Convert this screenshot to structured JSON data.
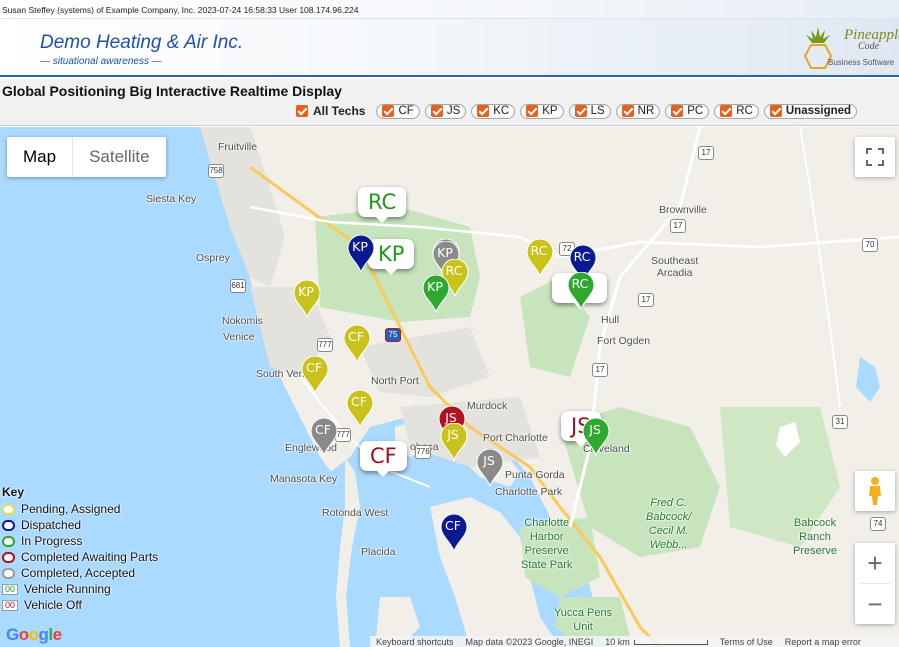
{
  "status_bar": "Susan Steffey (systems) of Example Company, Inc. 2023-07-24 16:58:33 User 108.174.96.224",
  "header": {
    "company": "Demo Heating & Air Inc.",
    "tagline": "— situational awareness —",
    "logo": {
      "name": "Pineapple",
      "sub": "Code",
      "biz": "Business Software"
    }
  },
  "page_title": "Global Positioning Big Interactive Realtime Display",
  "filters": {
    "all_label": "All Techs",
    "techs": [
      "CF",
      "JS",
      "KC",
      "KP",
      "LS",
      "NR",
      "PC",
      "RC"
    ],
    "unassigned_label": "Unassigned"
  },
  "map_controls": {
    "map_label": "Map",
    "satellite_label": "Satellite"
  },
  "markers": [
    {
      "label": "RC",
      "color": "#8a8a8a"
    },
    {
      "label": "KP",
      "color": "#0b1b8f"
    },
    {
      "label": "KP",
      "color": "#8a8a8a"
    },
    {
      "label": "RC",
      "color": "#c8c21a"
    },
    {
      "label": "KP",
      "color": "#2ea82e"
    },
    {
      "label": "RC",
      "color": "#c8c21a"
    },
    {
      "label": "RC",
      "color": "#0b1b8f"
    },
    {
      "label": "RC",
      "color": "#2ea82e"
    },
    {
      "label": "KP",
      "color": "#c8c21a"
    },
    {
      "label": "CF",
      "color": "#c8c21a"
    },
    {
      "label": "CF",
      "color": "#c8c21a"
    },
    {
      "label": "CF",
      "color": "#c8c21a"
    },
    {
      "label": "CF",
      "color": "#8a8a8a"
    },
    {
      "label": "JS",
      "color": "#b01020"
    },
    {
      "label": "JS",
      "color": "#c8c21a"
    },
    {
      "label": "JS",
      "color": "#8a8a8a"
    },
    {
      "label": "JS",
      "color": "#2ea82e"
    },
    {
      "label": "CF",
      "color": "#0b1b8f"
    }
  ],
  "callouts": [
    {
      "label": "RC",
      "color": "#1c9a1c"
    },
    {
      "label": "KP",
      "color": "#1c9a1c"
    },
    {
      "label": "",
      "color": "#1c9a1c"
    },
    {
      "label": "JS",
      "color": "#a01018"
    },
    {
      "label": "CF",
      "color": "#a01018"
    }
  ],
  "places": {
    "fruitville": "Fruitville",
    "siesta_key": "Siesta Key",
    "osprey": "Osprey",
    "nokomis": "Nokomis",
    "venice": "Venice",
    "south_venice": "South Venice",
    "north_port": "North Port",
    "murdock": "Murdock",
    "port_charlotte": "Port Charlotte",
    "englewood": "Englewood",
    "manasota_key": "Manasota Key",
    "boca": "oboca",
    "punta_gorda": "Punta Gorda",
    "charlotte_park": "Charlotte Park",
    "rotonda_west": "Rotonda West",
    "placida": "Placida",
    "arcadia": "Arcadia",
    "southeast_arcadia": "Southeast\nArcadia",
    "hull": "Hull",
    "fort_ogden": "Fort Ogden",
    "brownville": "Brownville",
    "cleveland": "Cleveland",
    "fred_c": "Fred C.\nBabcock/\nCecil M.\nWebb...",
    "babcock": "Babcock\nRanch\nPreserve",
    "harbor": "Charlotte\nHarbor\nPreserve\nState Park",
    "yucca": "Yucca Pens\nUnit"
  },
  "roads": [
    "758",
    "681",
    "777",
    "75",
    "72",
    "17",
    "70",
    "17",
    "17",
    "17",
    "777",
    "776",
    "31",
    "74"
  ],
  "key": {
    "title": "Key",
    "items": [
      {
        "label": "Pending, Assigned",
        "color": "#e8e040"
      },
      {
        "label": "Dispatched",
        "color": "#0b1b8f"
      },
      {
        "label": "In Progress",
        "color": "#2ea82e"
      },
      {
        "label": "Completed Awaiting Parts",
        "color": "#b01020"
      },
      {
        "label": "Completed, Accepted",
        "color": "#9a9a9a"
      }
    ],
    "vehicle": [
      {
        "code": "00",
        "label": "Vehicle Running",
        "color": "#1c9a1c"
      },
      {
        "code": "00",
        "label": "Vehicle Off",
        "color": "#b01020"
      }
    ]
  },
  "attribution": {
    "google": "Google",
    "shortcuts": "Keyboard shortcuts",
    "map_data": "Map data ©2023 Google, INEGI",
    "scale": "10 km",
    "terms": "Terms of Use",
    "report": "Report a map error"
  }
}
